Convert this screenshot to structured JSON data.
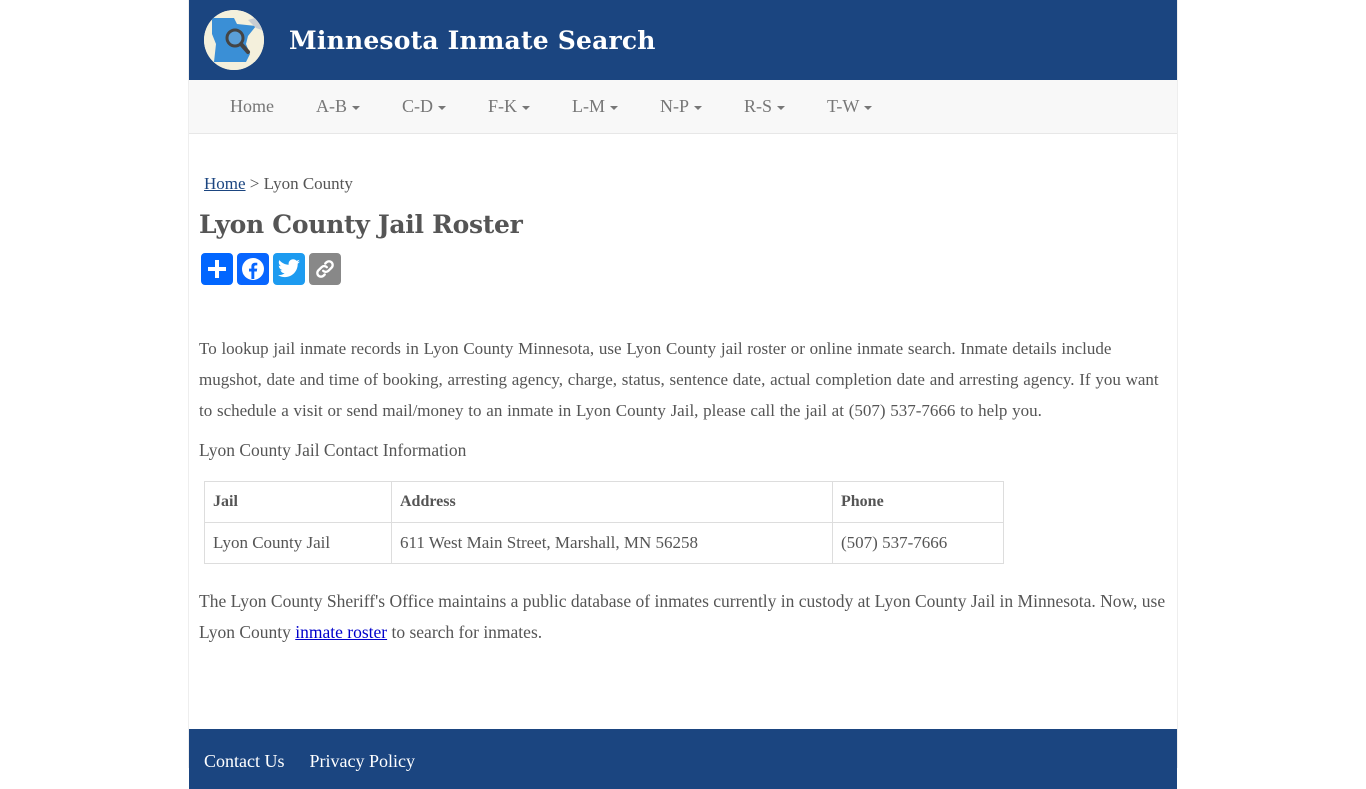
{
  "header": {
    "site_title": "Minnesota Inmate Search",
    "logo_icon": "minnesota-map-magnifier-icon"
  },
  "nav": {
    "items": [
      {
        "label": "Home",
        "dropdown": false
      },
      {
        "label": "A-B",
        "dropdown": true
      },
      {
        "label": "C-D",
        "dropdown": true
      },
      {
        "label": "F-K",
        "dropdown": true
      },
      {
        "label": "L-M",
        "dropdown": true
      },
      {
        "label": "N-P",
        "dropdown": true
      },
      {
        "label": "R-S",
        "dropdown": true
      },
      {
        "label": "T-W",
        "dropdown": true
      }
    ]
  },
  "breadcrumb": {
    "home": "Home",
    "separator": ">",
    "current": "Lyon County"
  },
  "page_title": "Lyon County Jail Roster",
  "share": {
    "buttons": [
      {
        "name": "share",
        "icon": "plus-icon",
        "color": "#0166ff"
      },
      {
        "name": "facebook",
        "icon": "facebook-icon",
        "color": "#0866ff"
      },
      {
        "name": "twitter",
        "icon": "twitter-icon",
        "color": "#1d9bf0"
      },
      {
        "name": "copy-link",
        "icon": "link-icon",
        "color": "#888888"
      }
    ]
  },
  "intro": "To lookup jail inmate records in Lyon County Minnesota, use Lyon County jail roster or online inmate search. Inmate details include mugshot, date and time of booking, arresting agency, charge, status, sentence date, actual completion date and arresting agency. If you want to schedule a visit or send mail/money to an inmate in Lyon County Jail, please call the jail at (507) 537-7666 to help you.",
  "contact_heading": "Lyon County Jail Contact Information",
  "table": {
    "headers": [
      "Jail",
      "Address",
      "Phone"
    ],
    "rows": [
      [
        "Lyon County Jail",
        "611 West Main Street, Marshall, MN 56258",
        "(507) 537-7666"
      ]
    ]
  },
  "outro": {
    "before": "The Lyon County Sheriff's Office maintains a public database of inmates currently in custody at Lyon County Jail in Minnesota. Now, use Lyon County ",
    "link": "inmate roster",
    "after": " to search for inmates."
  },
  "footer": {
    "links": [
      "Contact Us",
      "Privacy Policy"
    ]
  },
  "colors": {
    "brand": "#1b4580",
    "nav_bg": "#f8f8f8",
    "text": "#555555",
    "link": "#0000cc"
  }
}
